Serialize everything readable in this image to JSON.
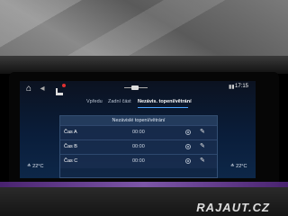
{
  "statusbar": {
    "home_icon": "home-icon",
    "back_icon": "back-icon",
    "seat_icon": "seat-heating-icon",
    "handle_icon": "drag-handle-icon",
    "status_icons": "signal-icon",
    "time": "17:15"
  },
  "tabs": [
    {
      "label": "Vpředu",
      "active": false
    },
    {
      "label": "Zadní část",
      "active": false
    },
    {
      "label": "Nezávis. topení/větrání",
      "active": true
    }
  ],
  "panel": {
    "title": "Nezávislé topení/větrání",
    "rows": [
      {
        "label": "Čas A",
        "time": "00:00"
      },
      {
        "label": "Čas B",
        "time": "00:00"
      },
      {
        "label": "Čas C",
        "time": "00:00"
      }
    ]
  },
  "temps": {
    "left": "≛ 22°C",
    "right": "≛ 22°C"
  },
  "watermark": "RAJAUT.CZ",
  "colors": {
    "screen_bg": "#0a1d3a",
    "accent": "#4aa3ff",
    "alert_dot": "#e03030"
  }
}
